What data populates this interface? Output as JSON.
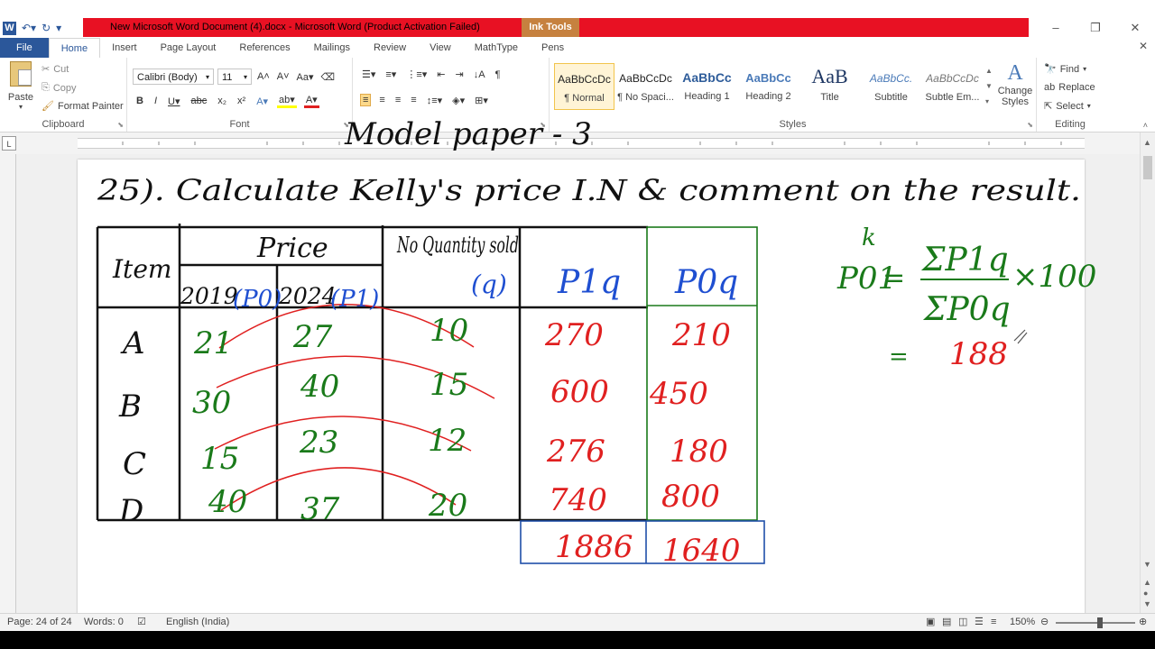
{
  "window": {
    "title": "New Microsoft Word Document (4).docx  -  Microsoft Word (Product Activation Failed)",
    "contextual_tab": "Ink Tools",
    "qat_icons": [
      "word-logo-icon",
      "undo-icon",
      "redo-icon",
      "customize-icon"
    ]
  },
  "tabs": [
    "File",
    "Home",
    "Insert",
    "Page Layout",
    "References",
    "Mailings",
    "Review",
    "View",
    "MathType",
    "Pens"
  ],
  "active_tab": "Home",
  "ribbon": {
    "clipboard": {
      "label": "Clipboard",
      "paste": "Paste",
      "cut": "Cut",
      "copy": "Copy",
      "format_painter": "Format Painter"
    },
    "font": {
      "label": "Font",
      "font_name": "Calibri (Body)",
      "font_size": "11"
    },
    "paragraph": {
      "label": "Paragraph"
    },
    "styles": {
      "label": "Styles",
      "items": [
        {
          "preview": "AaBbCcDc",
          "name": "¶ Normal"
        },
        {
          "preview": "AaBbCcDc",
          "name": "¶ No Spaci..."
        },
        {
          "preview": "AaBbCc",
          "name": "Heading 1"
        },
        {
          "preview": "AaBbCc",
          "name": "Heading 2"
        },
        {
          "preview": "AaB",
          "name": "Title"
        },
        {
          "preview": "AaBbCc.",
          "name": "Subtitle"
        },
        {
          "preview": "AaBbCcDc",
          "name": "Subtle Em..."
        }
      ],
      "change_styles": "Change Styles"
    },
    "editing": {
      "label": "Editing",
      "find": "Find",
      "replace": "Replace",
      "select": "Select"
    }
  },
  "ink_note": {
    "header": "Model paper - 3",
    "question": "25). Calculate Kelly's price I.N & comment on the result.",
    "table": {
      "headers": {
        "item": "Item",
        "price": "Price",
        "y2019": "2019",
        "p0": "(P0)",
        "y2024": "2024",
        "p1": "(P1)",
        "qty": "No Quantity sold",
        "q": "(q)",
        "p1q": "P1q",
        "p0q": "P0q"
      },
      "rows": [
        {
          "item": "A",
          "p0": "21",
          "p1": "27",
          "q": "10",
          "p1q": "270",
          "p0q": "210"
        },
        {
          "item": "B",
          "p0": "30",
          "p1": "40",
          "q": "15",
          "p1q": "600",
          "p0q": "450"
        },
        {
          "item": "C",
          "p0": "15",
          "p1": "23",
          "q": "12",
          "p1q": "276",
          "p0q": "180"
        },
        {
          "item": "D",
          "p0": "40",
          "p1": "37",
          "q": "20",
          "p1q": "740",
          "p0q": "800"
        }
      ],
      "totals": {
        "p1q": "1886",
        "p0q": "1640"
      }
    },
    "formula": {
      "lhs": "P01",
      "superscript": "k",
      "numerator": "ΣP1q",
      "denominator": "ΣP0q",
      "multiplier": "×100",
      "result_eq": "=",
      "result": "188"
    }
  },
  "status": {
    "page": "Page: 24 of 24",
    "words": "Words: 0",
    "language": "English (India)",
    "zoom": "150%"
  },
  "colors": {
    "title_red": "#e81123",
    "ink_tools": "#c6813f",
    "file_tab": "#2b579a",
    "ink_black": "#111111",
    "ink_green": "#1a7a1a",
    "ink_red": "#e02020",
    "ink_blue": "#1f4fd1",
    "ink_yellow": "#f2d23a",
    "table_green": "#1a7a1a",
    "total_blue": "#1f4fa8"
  }
}
